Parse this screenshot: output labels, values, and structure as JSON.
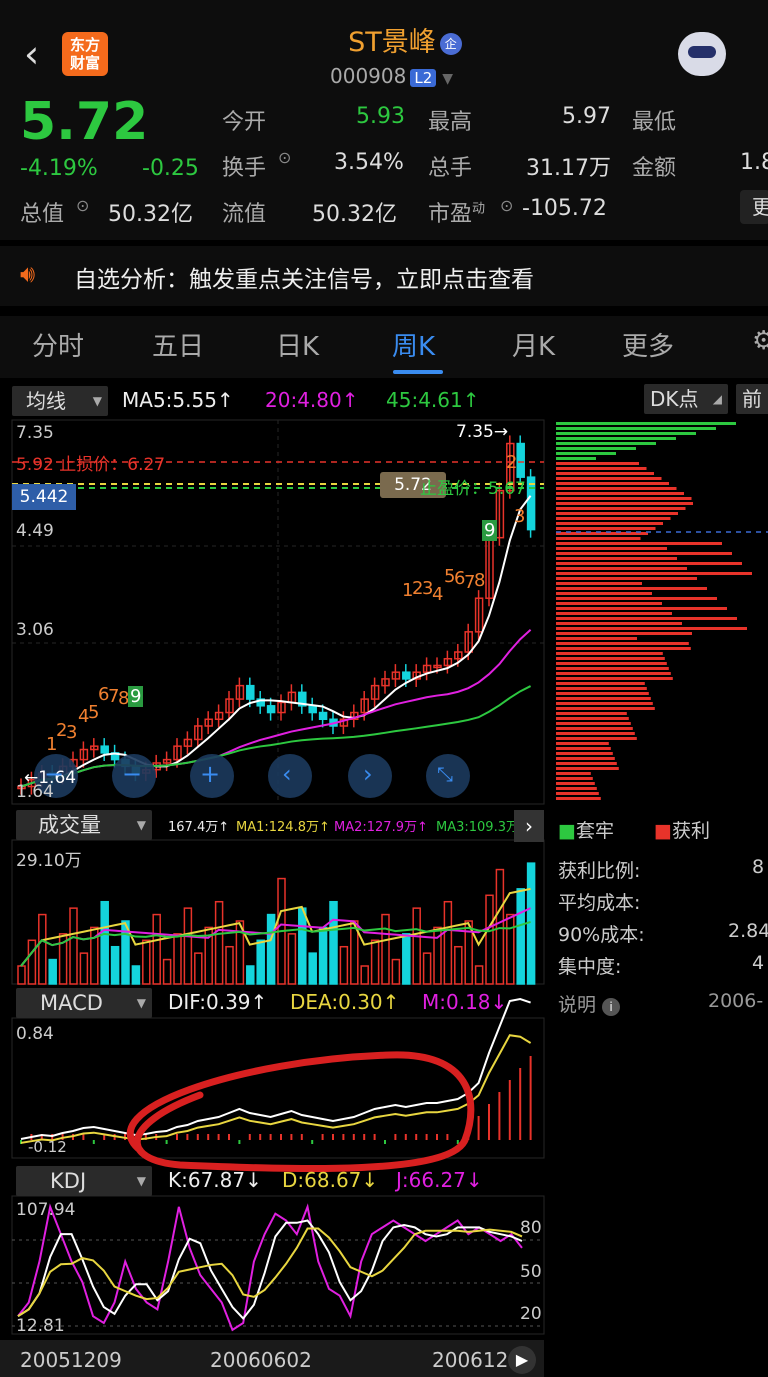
{
  "header": {
    "title": "ST景峰",
    "qi_badge": "企",
    "code": "000908",
    "level_badge": "L2",
    "logo_line1": "东方",
    "logo_line2": "财富"
  },
  "quote": {
    "price": "5.72",
    "change_pct": "-4.19%",
    "change": "-0.25",
    "total_value_label": "总值",
    "total_value": "50.32亿",
    "open_label": "今开",
    "open": "5.93",
    "high_label": "最高",
    "high": "5.97",
    "low_label": "最低",
    "turnover_label": "换手",
    "turnover": "3.54%",
    "volume_label": "总手",
    "volume": "31.17万",
    "amount_label": "金额",
    "amount": "1.8",
    "float_label": "流值",
    "float_value": "50.32亿",
    "pe_label": "市盈",
    "pe_sup": "动",
    "pe": "-105.72",
    "more": "更"
  },
  "notice": {
    "text": "自选分析：触发重点关注信号，立即点击查看"
  },
  "tabs": [
    "分时",
    "五日",
    "日K",
    "周K",
    "月K",
    "更多"
  ],
  "active_tab": "周K",
  "ma_bar": {
    "selector": "均线",
    "ma5": "MA5:5.55↑",
    "ma20": "20:4.80↑",
    "ma45": "45:4.61↑",
    "dk": "DK点",
    "front": "前"
  },
  "kline": {
    "y_labels": [
      "7.35",
      "4.49",
      "3.06",
      "1.64"
    ],
    "hi_label": "7.35→",
    "lo_label": "←1.64",
    "stop_loss": "止损价：6.27",
    "stop_loss_prefix": "5.92",
    "take_profit": "止盈价：5.67",
    "current_box": "5.72",
    "cross_price": "5.442",
    "seq_numbers": [
      "1",
      "2",
      "3",
      "4",
      "5",
      "6",
      "7",
      "8",
      "9",
      "1",
      "2",
      "3",
      "4",
      "5",
      "6",
      "7",
      "8",
      "9",
      "2",
      "3"
    ]
  },
  "volume_bar": {
    "selector": "成交量",
    "v": "167.4万↑",
    "ma1": "MA1:124.8万↑",
    "ma2": "MA2:127.9万↑",
    "ma3": "MA3:109.3万↑",
    "y_label": "29.10万"
  },
  "macd_bar": {
    "selector": "MACD",
    "dif": "DIF:0.39↑",
    "dea": "DEA:0.30↑",
    "m": "M:0.18↓",
    "y_top": "0.84",
    "y_bottom": "-0.12"
  },
  "kdj_bar": {
    "selector": "KDJ",
    "k": "K:67.87↓",
    "d": "D:68.67↓",
    "j": "J:66.27↓",
    "y_top": "107.94",
    "y_bottom": "12.81",
    "levels": [
      "80",
      "50",
      "20"
    ]
  },
  "dates": [
    "20051209",
    "20060602",
    "200612"
  ],
  "chips": {
    "trapped": "套牢",
    "profit": "获利",
    "profit_ratio_label": "获利比例:",
    "profit_ratio": "8",
    "avg_cost_label": "平均成本:",
    "cost90_label": "90%成本:",
    "cost90": "2.84",
    "concentration_label": "集中度:",
    "concentration": "4",
    "note_label": "说明",
    "note_date": "2006-"
  },
  "colors": {
    "up": "#e8332a",
    "down": "#14d4dc",
    "green": "#2dc840",
    "accent": "#3a8cf0",
    "yellow": "#e8d640",
    "magenta": "#e020e0"
  }
}
